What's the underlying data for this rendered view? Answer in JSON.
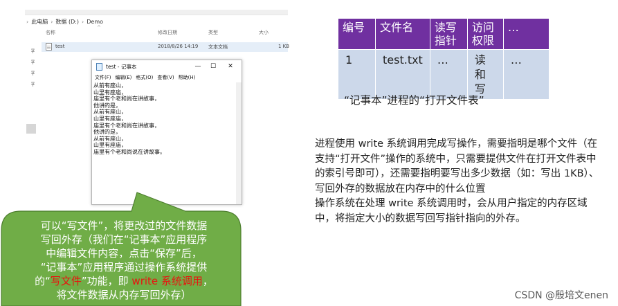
{
  "explorer": {
    "breadcrumb": [
      "此电脑",
      "数据 (D:)",
      "Demo"
    ],
    "columns": {
      "name": "名称",
      "modified": "修改日期",
      "type": "类型",
      "size": "大小"
    },
    "file": {
      "name": "test",
      "modified": "2018/8/26 14:19",
      "type": "文本文档",
      "size": "1 KB"
    }
  },
  "notepad": {
    "title": "test - 记事本",
    "menu": [
      "文件(F)",
      "编辑(E)",
      "格式(O)",
      "查看(V)",
      "帮助(H)"
    ],
    "controls": {
      "minimize": "—",
      "maximize": "☐",
      "close": "✕"
    },
    "content": "从前有座山，\n山里有座庙，\n庙里有个老和尚在讲故事，\n他讲的是，\n从前有座山，\n山里有座庙，\n庙里有个老和尚在讲故事，\n他讲的是，\n从前有座山，\n山里有座庙，\n庙里有个老和尚说在讲故事。"
  },
  "callout": {
    "line1": "可以“写文件”，将更改过的文件数据",
    "line2": "写回外存（我们在“记事本”应用程序",
    "line3": "中编辑文件内容，点击“保存”后，",
    "line4": "“记事本”应用程序通过操作系统提供",
    "line5_a": "的“",
    "line5_red1": "写文件",
    "line5_b": "”功能，即 ",
    "line5_red2": "write 系统调用",
    "line5_c": "，",
    "line6": "将文件数据从内存写回外存）",
    "color": "#70ad47"
  },
  "open_file_table": {
    "headers": [
      "编号",
      "文件名",
      "读写指针",
      "访问权限",
      "…"
    ],
    "rows": [
      [
        "1",
        "test.txt",
        "…",
        "读和写",
        "…"
      ]
    ],
    "header_color": "#7030a0",
    "row_color": "#ccd8ea"
  },
  "caption": "“记事本”进程的“打开文件表”",
  "description": {
    "para1": "进程使用 write 系统调用完成写操作，需要指明是哪个文件（在支持“打开文件”操作的系统中，只需要提供文件在打开文件表中的索引号即可），还需要指明要写出多少数据（如：写出 1KB）、写回外存的数据放在内存中的什么位置",
    "para2": "操作系统在处理 write 系统调用时，会从用户指定的内存区域中，将指定大小的数据写回写指针指向的外存。"
  },
  "watermark": "CSDN @殷培文enen"
}
